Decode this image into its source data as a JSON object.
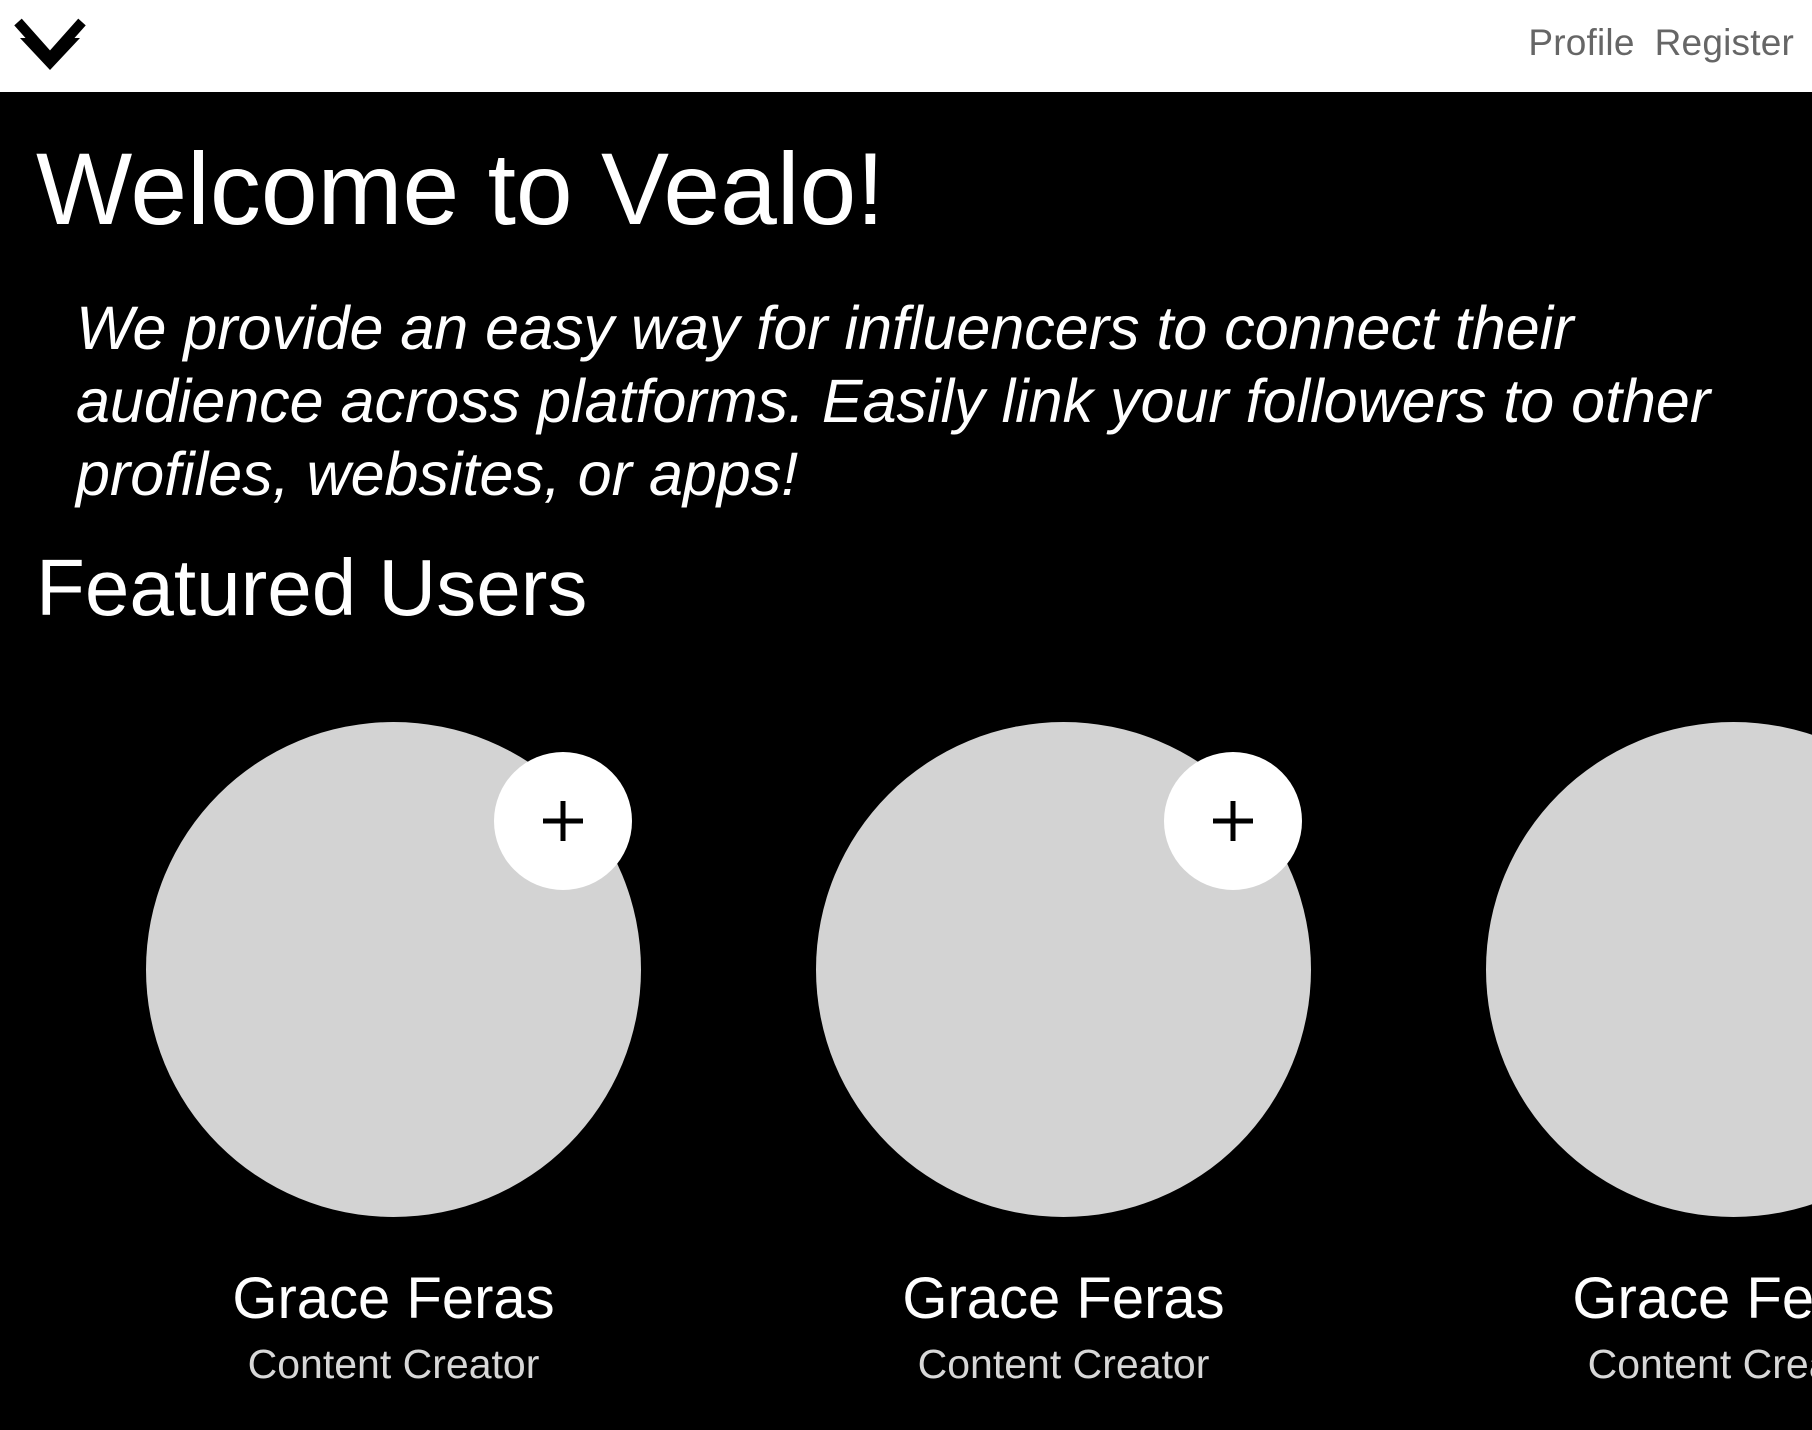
{
  "nav": {
    "logo_icon": "vealo-logo-icon",
    "items": [
      {
        "label": "Profile"
      },
      {
        "label": "Register"
      }
    ]
  },
  "hero": {
    "title": "Welcome to Vealo!",
    "tagline": "We provide an easy way for influencers to connect their audience across platforms. Easily link your followers to other profiles, websites, or apps!"
  },
  "featured": {
    "title": "Featured Users",
    "users": [
      {
        "name": "Grace Feras",
        "role": "Content Creator",
        "follow_icon": "plus-icon"
      },
      {
        "name": "Grace Feras",
        "role": "Content Creator",
        "follow_icon": "plus-icon"
      },
      {
        "name": "Grace Feras",
        "role": "Content Creator",
        "follow_icon": "plus-icon"
      }
    ]
  },
  "colors": {
    "background": "#000000",
    "header": "#ffffff",
    "avatar_placeholder": "#d3d3d3",
    "text": "#ffffff"
  }
}
